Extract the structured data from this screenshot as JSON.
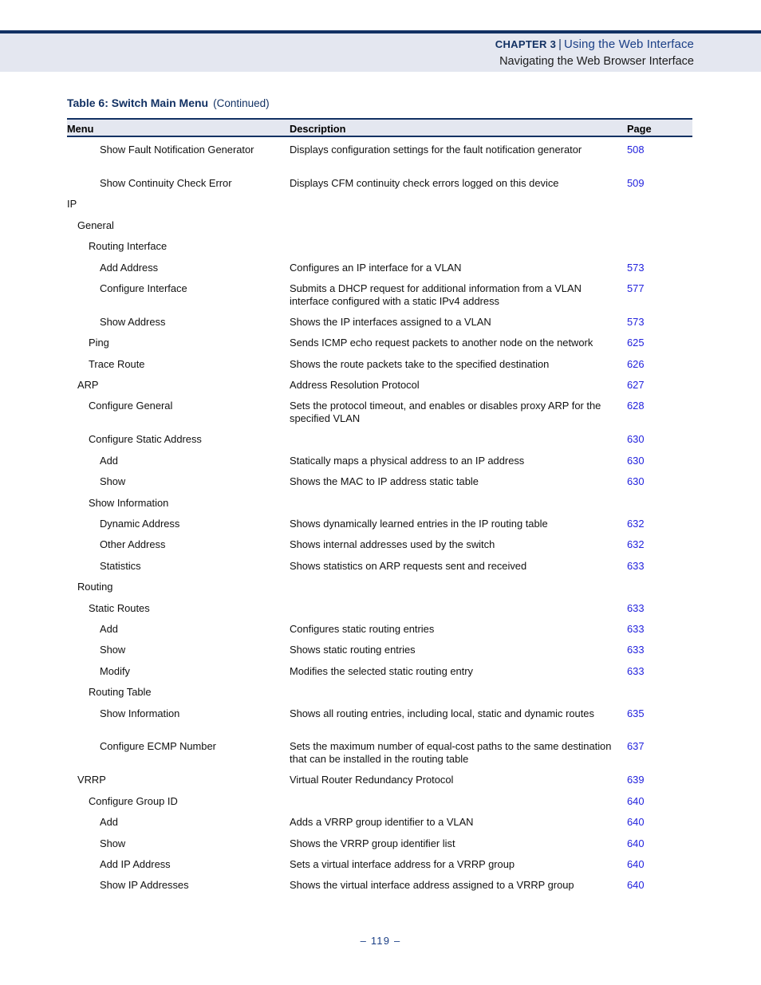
{
  "header": {
    "chapter_label": "CHAPTER 3",
    "separator": "|",
    "chapter_title": "Using the Web Interface",
    "section_title": "Navigating the Web Browser Interface"
  },
  "caption": {
    "title": "Table 6: Switch Main Menu",
    "continued": "(Continued)"
  },
  "columns": {
    "menu": "Menu",
    "description": "Description",
    "page": "Page"
  },
  "rows": [
    {
      "level": 3,
      "menu": "Show Fault Notification Generator",
      "description": "Displays configuration settings for the fault notification generator",
      "page": "508"
    },
    {
      "level": 3,
      "menu": "Show Continuity Check Error",
      "description": "Displays CFM continuity check errors logged on this device",
      "page": "509"
    },
    {
      "level": 0,
      "menu": "IP",
      "description": "",
      "page": ""
    },
    {
      "level": 1,
      "menu": "General",
      "description": "",
      "page": ""
    },
    {
      "level": 2,
      "menu": "Routing Interface",
      "description": "",
      "page": ""
    },
    {
      "level": 3,
      "menu": "Add Address",
      "description": "Configures an IP interface for a VLAN",
      "page": "573"
    },
    {
      "level": 3,
      "menu": "Configure Interface",
      "description": "Submits a DHCP request for additional information from a VLAN interface configured with a static IPv4 address",
      "page": "577"
    },
    {
      "level": 3,
      "menu": "Show Address",
      "description": "Shows the IP interfaces assigned to a VLAN",
      "page": "573"
    },
    {
      "level": 2,
      "menu": "Ping",
      "description": "Sends ICMP echo request packets to another node on the network",
      "page": "625"
    },
    {
      "level": 2,
      "menu": "Trace Route",
      "description": "Shows the route packets take to the specified destination",
      "page": "626"
    },
    {
      "level": 1,
      "menu": "ARP",
      "description": "Address Resolution Protocol",
      "page": "627"
    },
    {
      "level": 2,
      "menu": "Configure General",
      "description": "Sets the protocol timeout, and enables or disables proxy ARP for the specified VLAN",
      "page": "628"
    },
    {
      "level": 2,
      "menu": "Configure Static Address",
      "description": "",
      "page": "630"
    },
    {
      "level": 3,
      "menu": "Add",
      "description": "Statically maps a physical address to an IP address",
      "page": "630"
    },
    {
      "level": 3,
      "menu": "Show",
      "description": "Shows the MAC to IP address static table",
      "page": "630"
    },
    {
      "level": 2,
      "menu": "Show Information",
      "description": "",
      "page": ""
    },
    {
      "level": 3,
      "menu": "Dynamic Address",
      "description": "Shows dynamically learned entries in the IP routing table",
      "page": "632"
    },
    {
      "level": 3,
      "menu": "Other Address",
      "description": "Shows internal addresses used by the switch",
      "page": "632"
    },
    {
      "level": 3,
      "menu": "Statistics",
      "description": "Shows statistics on ARP requests sent and received",
      "page": "633"
    },
    {
      "level": 1,
      "menu": "Routing",
      "description": "",
      "page": ""
    },
    {
      "level": 2,
      "menu": "Static Routes",
      "description": "",
      "page": "633"
    },
    {
      "level": 3,
      "menu": "Add",
      "description": "Configures static routing entries",
      "page": "633"
    },
    {
      "level": 3,
      "menu": "Show",
      "description": "Shows static routing entries",
      "page": "633"
    },
    {
      "level": 3,
      "menu": "Modify",
      "description": "Modifies the selected static routing entry",
      "page": "633"
    },
    {
      "level": 2,
      "menu": "Routing Table",
      "description": "",
      "page": ""
    },
    {
      "level": 3,
      "menu": "Show Information",
      "description": "Shows all routing entries, including local, static and dynamic routes",
      "page": "635"
    },
    {
      "level": 3,
      "menu": "Configure ECMP Number",
      "description": "Sets the maximum number of equal-cost paths to the same destination that can be installed in the routing table",
      "page": "637"
    },
    {
      "level": 1,
      "menu": "VRRP",
      "description": "Virtual Router Redundancy Protocol",
      "page": "639"
    },
    {
      "level": 2,
      "menu": "Configure Group ID",
      "description": "",
      "page": "640"
    },
    {
      "level": 3,
      "menu": "Add",
      "description": "Adds a VRRP group identifier to a VLAN",
      "page": "640"
    },
    {
      "level": 3,
      "menu": "Show",
      "description": "Shows the VRRP group identifier list",
      "page": "640"
    },
    {
      "level": 3,
      "menu": "Add IP Address",
      "description": "Sets a virtual interface address for a VRRP group",
      "page": "640"
    },
    {
      "level": 3,
      "menu": "Show IP Addresses",
      "description": "Shows the virtual interface address assigned to a VRRP group",
      "page": "640"
    }
  ],
  "footer": {
    "page_number": "–   119   –"
  },
  "colors": {
    "rule_navy": "#123163",
    "band_bg": "#e4e7f0",
    "link_blue": "#2222dd",
    "chapter_title_blue": "#1b3f86"
  }
}
